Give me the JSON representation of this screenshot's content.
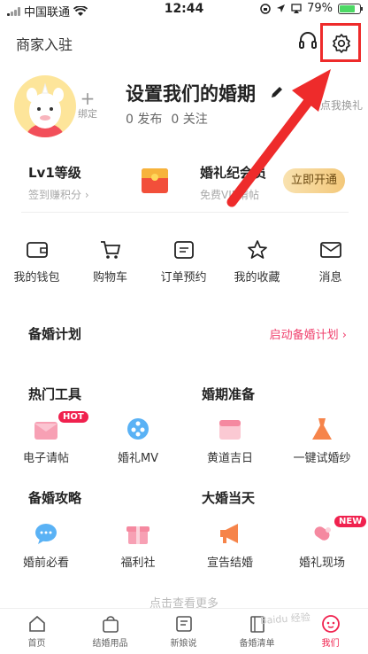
{
  "status_bar": {
    "carrier": "中国联通",
    "time": "12:44",
    "battery": "79%",
    "battery_level": 0.79
  },
  "header": {
    "merchant_label": "商家入驻",
    "icons": [
      "headset-icon",
      "settings-gear-icon"
    ]
  },
  "profile": {
    "bind_plus": "+",
    "bind_label": "绑定",
    "nickname": "设置我们的婚期",
    "stats": {
      "posts": "0 发布",
      "following": "0 关注"
    },
    "swap_label": "点我换礼"
  },
  "cards": {
    "level": {
      "title": "Lv1等级",
      "subtitle": "签到赚积分 ›"
    },
    "vip": {
      "title": "婚礼纪会员",
      "subtitle": "免费VIP请帖",
      "button": "立即开通"
    }
  },
  "quick_links": [
    {
      "label": "我的钱包",
      "icon": "wallet-icon"
    },
    {
      "label": "购物车",
      "icon": "cart-icon"
    },
    {
      "label": "订单预约",
      "icon": "order-icon"
    },
    {
      "label": "我的收藏",
      "icon": "star-icon"
    },
    {
      "label": "消息",
      "icon": "message-icon"
    }
  ],
  "plan": {
    "title": "备婚计划",
    "link": "启动备婚计划 ›"
  },
  "sections": {
    "hot_tools": "热门工具",
    "prep": "婚期准备",
    "guide": "备婚攻略",
    "wedding_day": "大婚当天"
  },
  "tools_row1": [
    {
      "label": "电子请帖",
      "icon": "invitation-icon",
      "badge": "HOT"
    },
    {
      "label": "婚礼MV",
      "icon": "film-reel-icon"
    },
    {
      "label": "黄道吉日",
      "icon": "calendar-icon"
    },
    {
      "label": "一键试婚纱",
      "icon": "dress-icon"
    }
  ],
  "tools_row2": [
    {
      "label": "婚前必看",
      "icon": "chat-bubble-icon"
    },
    {
      "label": "福利社",
      "icon": "gift-box-icon"
    },
    {
      "label": "宣告结婚",
      "icon": "megaphone-icon"
    },
    {
      "label": "婚礼现场",
      "icon": "candy-icon",
      "badge": "NEW"
    }
  ],
  "more_label": "点击查看更多",
  "tabs": [
    {
      "label": "首页",
      "icon": "home-icon"
    },
    {
      "label": "结婚用品",
      "icon": "shopping-bag-icon"
    },
    {
      "label": "新娘说",
      "icon": "note-icon"
    },
    {
      "label": "备婚清单",
      "icon": "book-icon"
    },
    {
      "label": "我们",
      "icon": "profile-icon",
      "active": true
    }
  ],
  "watermark": "Baidu 经验",
  "colors": {
    "accent": "#f0214e",
    "annotation": "#ee2b2b",
    "vip_gold": "#f3c87a"
  }
}
